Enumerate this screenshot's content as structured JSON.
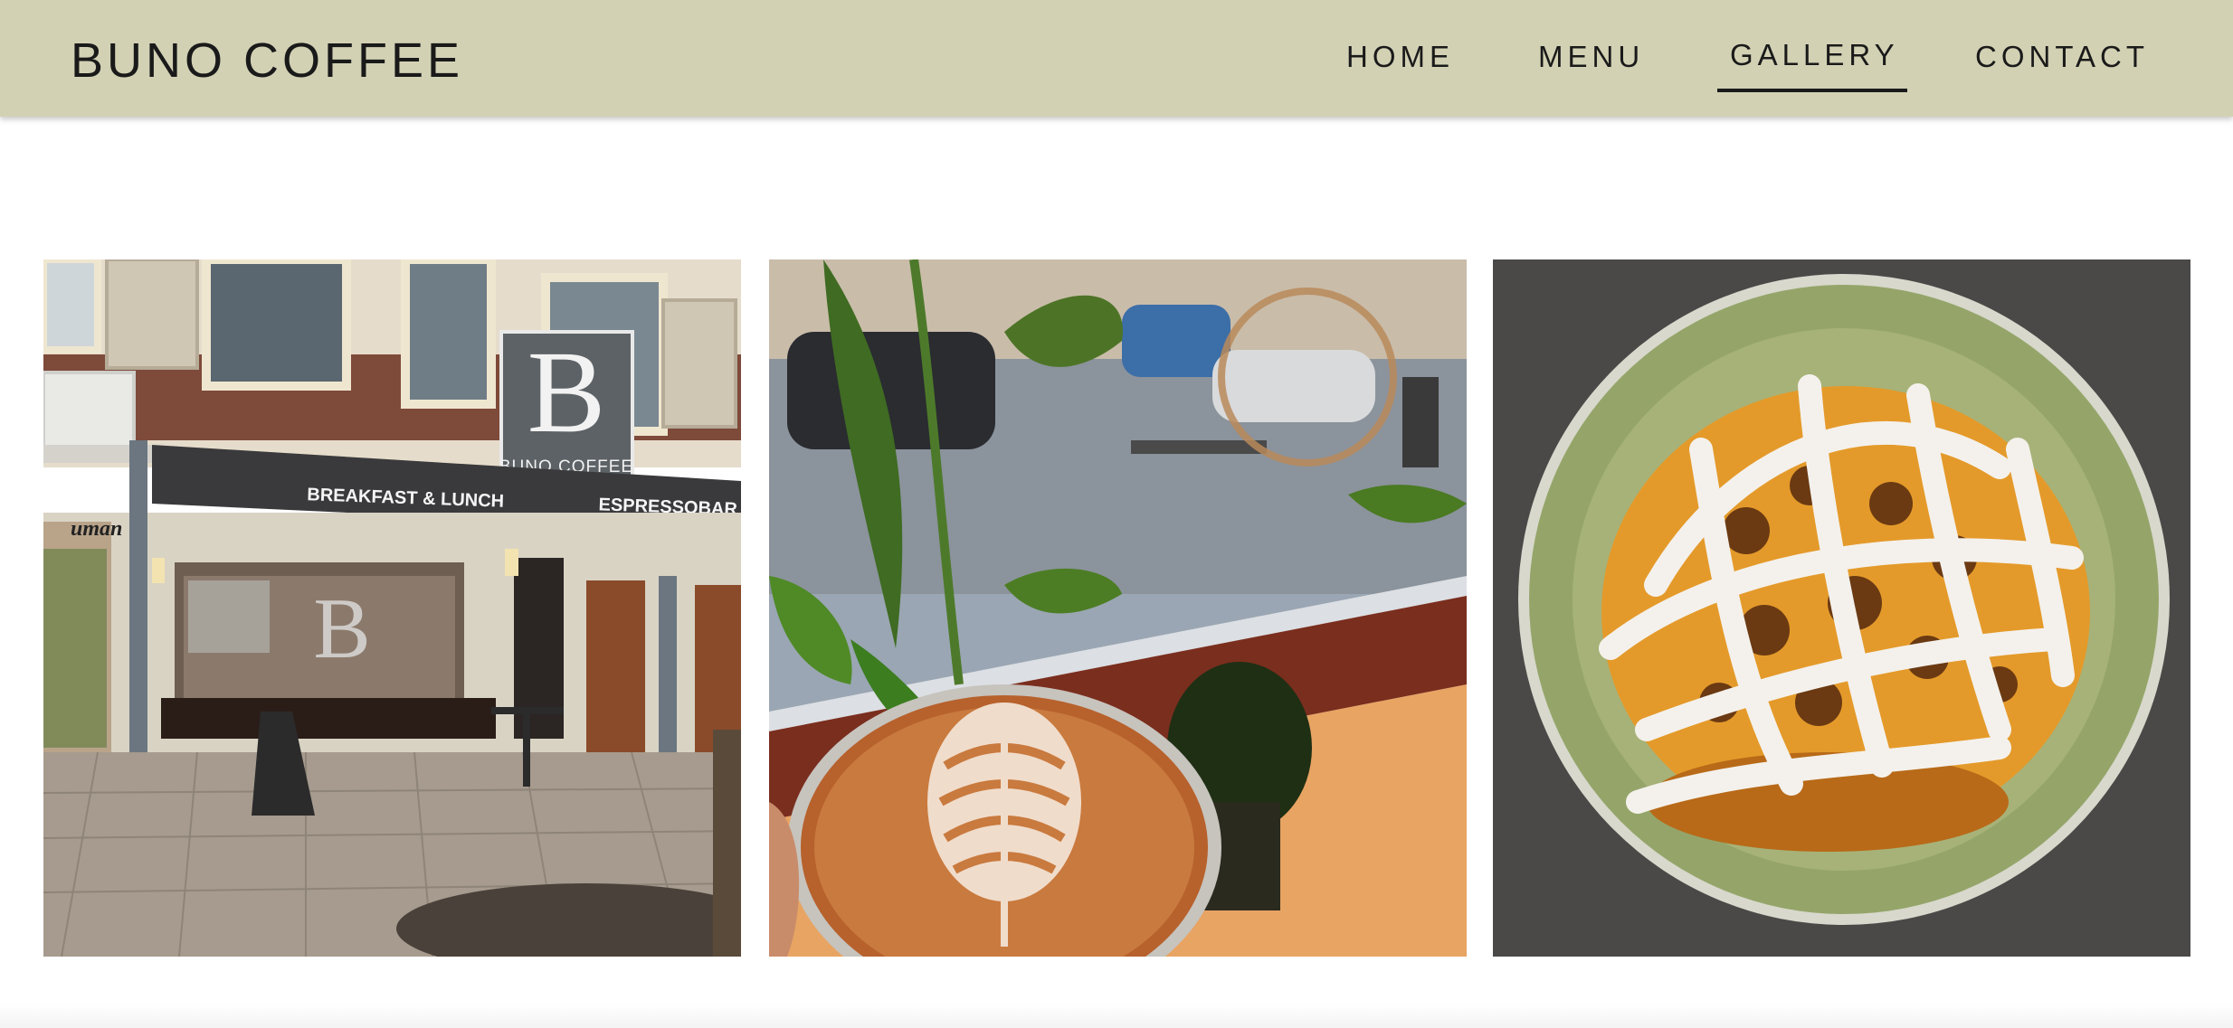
{
  "header": {
    "brand": "BUNO COFFEE",
    "nav": [
      {
        "label": "HOME",
        "active": false
      },
      {
        "label": "MENU",
        "active": false
      },
      {
        "label": "GALLERY",
        "active": true
      },
      {
        "label": "CONTACT",
        "active": false
      }
    ]
  },
  "gallery": {
    "photos": [
      {
        "subject": "storefront",
        "sign_logo": "B",
        "sign_text": "BUNO COFFEE",
        "awning_left": "BREAKFAST & LUNCH",
        "awning_right": "ESPRESSOBAR",
        "neighbor_sign": "uman"
      },
      {
        "subject": "latte-art-cup"
      },
      {
        "subject": "cinnamon-roll-plate"
      }
    ]
  },
  "colors": {
    "header_bg": "#d3d1b4",
    "text": "#1a1a1a",
    "page_bg": "#ffffff"
  }
}
